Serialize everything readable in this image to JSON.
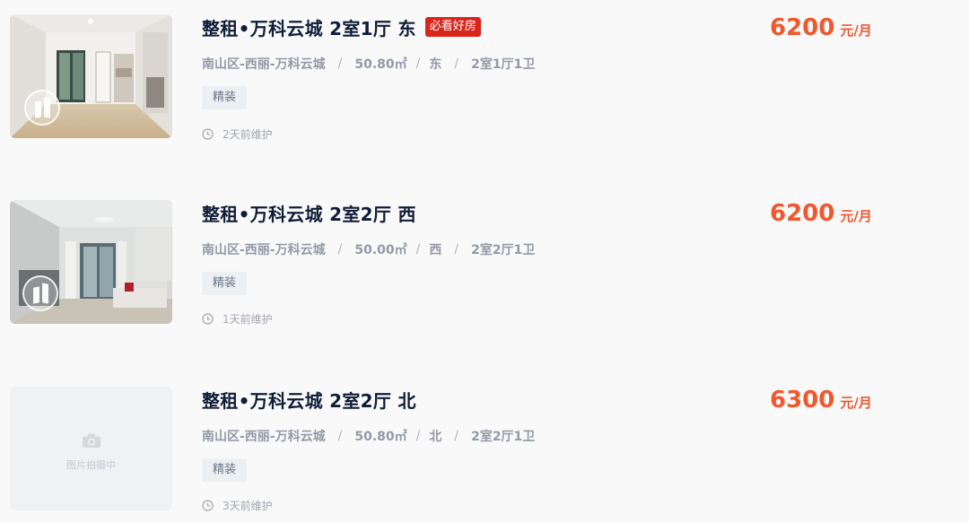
{
  "colors": {
    "accent": "#f0582e",
    "hot_tag": "#d9261c",
    "title": "#101d37",
    "meta": "#9399a5"
  },
  "listings": [
    {
      "title": "整租•万科云城 2室1厅 东",
      "badge": "必看好房",
      "meta": {
        "district": "南山区-西丽-万科云城",
        "area": "50.80㎡",
        "orientation": "东",
        "layout": "2室1厅1卫"
      },
      "decoration": "精装",
      "updated": "2天前维护",
      "price": "6200",
      "price_unit": "元/月",
      "has_photo": true
    },
    {
      "title": "整租•万科云城 2室2厅 西",
      "meta": {
        "district": "南山区-西丽-万科云城",
        "area": "50.00㎡",
        "orientation": "西",
        "layout": "2室2厅1卫"
      },
      "decoration": "精装",
      "updated": "1天前维护",
      "price": "6200",
      "price_unit": "元/月",
      "has_photo": true
    },
    {
      "title": "整租•万科云城 2室2厅 北",
      "meta": {
        "district": "南山区-西丽-万科云城",
        "area": "50.80㎡",
        "orientation": "北",
        "layout": "2室2厅1卫"
      },
      "decoration": "精装",
      "updated": "3天前维护",
      "price": "6300",
      "price_unit": "元/月",
      "has_photo": false,
      "placeholder_text": "图片拍摄中"
    }
  ],
  "icons": {
    "vr": "vr-panorama-icon",
    "clock": "clock-icon",
    "camera": "camera-icon"
  }
}
